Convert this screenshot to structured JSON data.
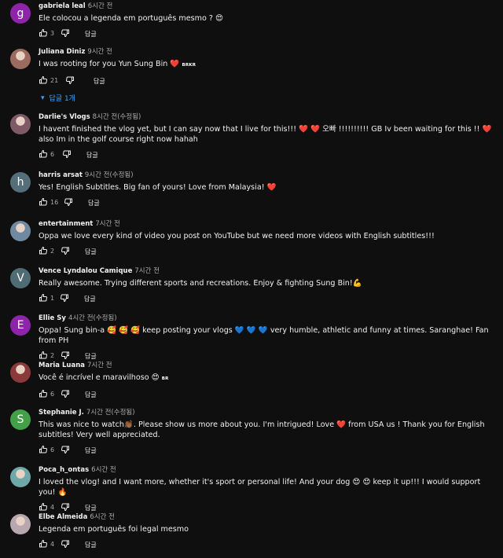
{
  "labels": {
    "reply": "답글"
  },
  "comments": [
    {
      "author": "gabriela leal",
      "time": "6시간 전",
      "text": "Ele colocou a legenda em português mesmo ? 😍",
      "likes": "3",
      "avatar_letter": "g",
      "avatar_color": "#8e24aa"
    },
    {
      "author": "Juliana Diniz",
      "time": "9시간 전",
      "text": "I was rooting for you Yun Sung Bin ❤️",
      "flag": "BRKR",
      "likes": "21",
      "avatar_color": "#9a6b5e",
      "replies": "답글 1개"
    },
    {
      "author": "Darlie's Vlogs",
      "time": "8시간 전(수정됨)",
      "text": "I havent finished the vlog yet, but I can say now that I live for this!!! ❤️ ❤️ 오빠 !!!!!!!!!! GB Iv been waiting for this !! ❤️ also Im in the golf course right now hahah",
      "likes": "6",
      "avatar_color": "#7d5a66"
    },
    {
      "author": "harris arsat",
      "time": "9시간 전(수정됨)",
      "text": "Yes! English Subtitles. Big fan of yours! Love from Malaysia! ❤️",
      "likes": "16",
      "avatar_letter": "h",
      "avatar_color": "#546e7a"
    },
    {
      "author": "entertainment",
      "time": "7시간 전",
      "text": "Oppa we love every kind of video you post on YouTube but we need more videos with English subtitles!!!",
      "likes": "2",
      "avatar_color": "#6f8aa0"
    },
    {
      "author": "Vence Lyndalou Camique",
      "time": "7시간 전",
      "text": "Really awesome. Trying different sports and recreations.  Enjoy & fighting Sung Bin!💪",
      "likes": "1",
      "avatar_letter": "V",
      "avatar_color": "#4f6b73"
    },
    {
      "author": "Ellie Sy",
      "time": "4시간 전(수정됨)",
      "text": "Oppa! Sung bin-a 🥰 🥰 🥰 keep posting your vlogs 💙 💙 💙 very humble, athletic and funny at times. Saranghae! Fan from PH",
      "likes": "2",
      "avatar_letter": "E",
      "avatar_color": "#8e24aa"
    },
    {
      "author": "Maria Luana",
      "time": "7시간 전",
      "text": "Você é incrível e maravilhoso 😍",
      "flag": "BR",
      "likes": "6",
      "avatar_color": "#8a3a3a"
    },
    {
      "author": "Stephanie J.",
      "time": "7시간 전(수정됨)",
      "text": "This was nice to watch👏🏾. Please show us more about you. I'm intrigued! Love ❤️  from USA us ! Thank you for English subtitles! Very well appreciated.",
      "likes": "6",
      "avatar_letter": "S",
      "avatar_color": "#43a047"
    },
    {
      "author": "Poca_h_ontas",
      "time": "6시간 전",
      "text": "I loved the vlog! and I want more, whether it's sport or personal life! And your dog 😍 😍  keep it up!!! I would support you! 🔥",
      "likes": "4",
      "avatar_color": "#6fa8a8"
    },
    {
      "author": "Elbe Almeida",
      "time": "6시간 전",
      "text": "Legenda em português foi legal mesmo",
      "likes": "4",
      "avatar_color": "#b9a7b0"
    }
  ]
}
